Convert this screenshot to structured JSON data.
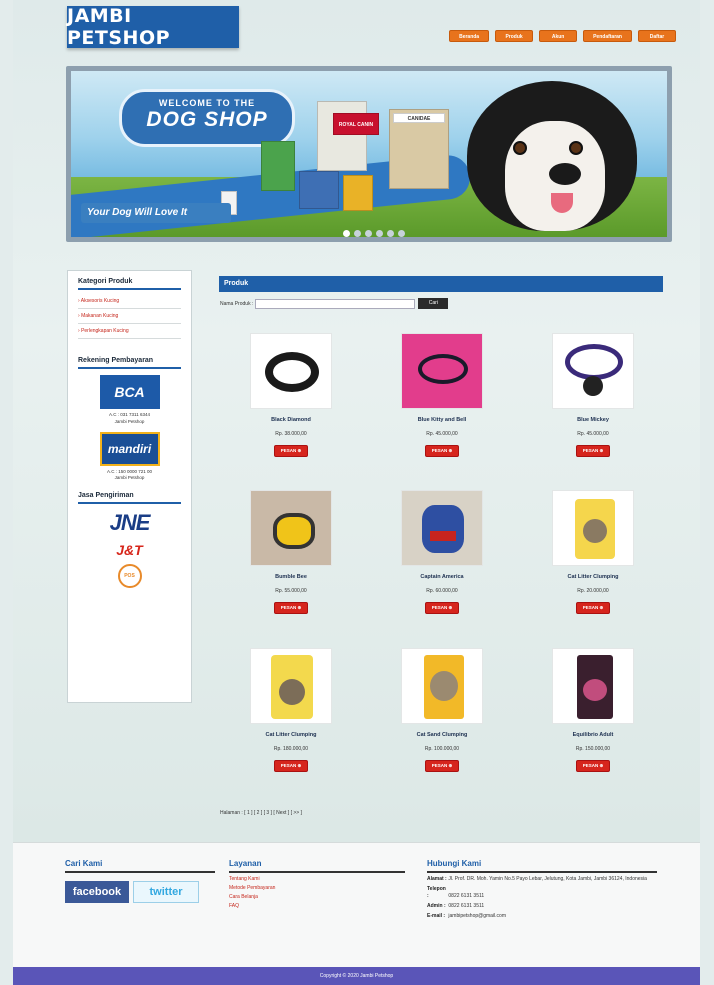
{
  "brand": "JAMBI PETSHOP",
  "topnav": [
    "Beranda",
    "Produk",
    "Akun",
    "Pendaftaran",
    "Daftar"
  ],
  "banner": {
    "welcome": "WELCOME TO THE",
    "shop": "DOG SHOP",
    "tagline": "Your Dog Will Love It",
    "bag1": "ROYAL CANIN",
    "bag2": "CANIDAE"
  },
  "sidebar": {
    "category_title": "Kategori Produk",
    "categories": [
      "Aksesoris Kucing",
      "Makanan Kucing",
      "Perlengkapan Kucing"
    ],
    "bank_title": "Rekening Pembayaran",
    "banks": [
      {
        "logo": "BCA",
        "account": "A.C : 031 7311 6344",
        "owner": "Jambi Petshop",
        "color": "#1d5aa8"
      },
      {
        "logo": "mandiri",
        "account": "A.C : 150 0000 721 00",
        "owner": "Jambi Petshop",
        "color": "#1a4f96"
      }
    ],
    "ship_title": "Jasa Pengiriman",
    "couriers": [
      "JNE",
      "J&T",
      "POS"
    ]
  },
  "main": {
    "heading": "Produk",
    "search_label": "Nama Produk :",
    "search_button": "Cari",
    "products": [
      {
        "name": "Black Diamond",
        "price": "Rp. 38.000,00",
        "button": "PESAN"
      },
      {
        "name": "Blue Kitty and Bell",
        "price": "Rp. 45.000,00",
        "button": "PESAN"
      },
      {
        "name": "Blue Mickey",
        "price": "Rp. 45.000,00",
        "button": "PESAN"
      },
      {
        "name": "Bumble Bee",
        "price": "Rp. 55.000,00",
        "button": "PESAN"
      },
      {
        "name": "Captain America",
        "price": "Rp. 60.000,00",
        "button": "PESAN"
      },
      {
        "name": "Cat Litter Clumping",
        "price": "Rp. 20.000,00",
        "button": "PESAN"
      },
      {
        "name": "Cat Litter Clumping",
        "price": "Rp. 180.000,00",
        "button": "PESAN"
      },
      {
        "name": "Cat Sand Clumping",
        "price": "Rp. 100.000,00",
        "button": "PESAN"
      },
      {
        "name": "Equilibrio Adult",
        "price": "Rp. 150.000,00",
        "button": "PESAN"
      }
    ],
    "pager": "Halaman : [ 1 ] [ 2 ] [ 3 ] [ Next ] [ >> ]"
  },
  "footer": {
    "find_title": "Cari Kami",
    "facebook": "facebook",
    "twitter": "twitter",
    "service_title": "Layanan",
    "services": [
      "Tentang Kami",
      "Metode Pembayaran",
      "Cara Belanja",
      "FAQ"
    ],
    "contact_title": "Hubungi Kami",
    "address_label": "Alamat :",
    "address": "Jl. Prof. DR. Moh. Yamin No.5 Payo Lebar, Jelutung, Kota Jambi, Jambi 36124, Indonesia",
    "phone_label": "Telepon :",
    "phone": "0822 6131 3511",
    "admin_label": "Admin :",
    "admin": "0822 6131 3511",
    "email_label": "E-mail :",
    "email": "jambipetshop@gmail.com",
    "copyright": "Copyright © 2020 Jambi Petshop"
  }
}
